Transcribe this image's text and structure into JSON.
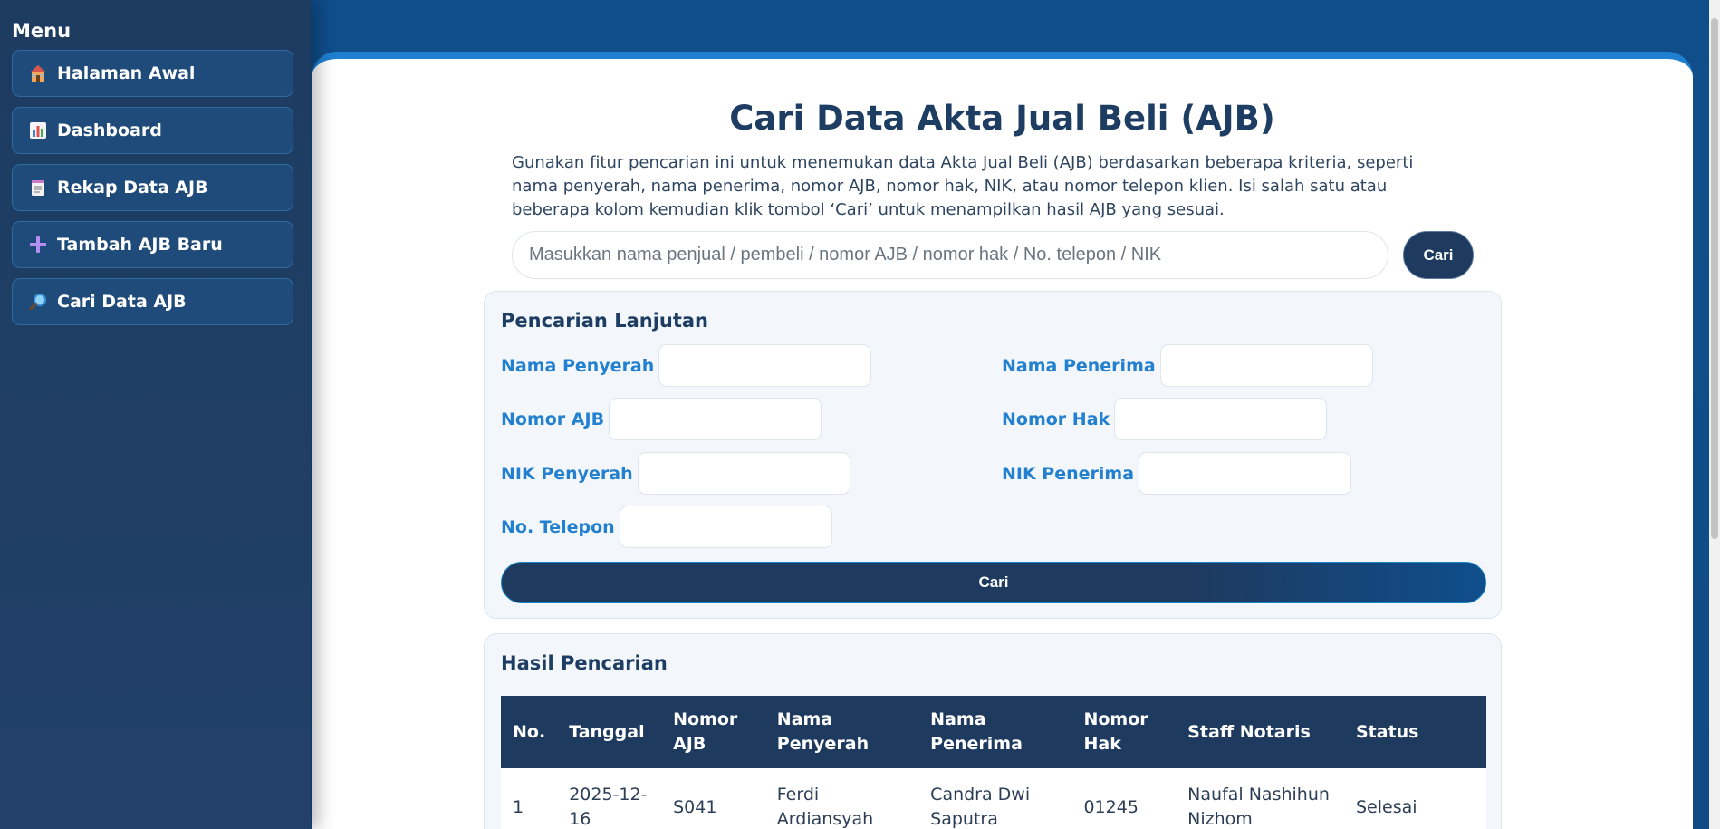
{
  "sidebar": {
    "title": "Menu",
    "items": [
      {
        "label": "Halaman Awal",
        "icon": "house-icon"
      },
      {
        "label": "Dashboard",
        "icon": "bar-chart-icon"
      },
      {
        "label": "Rekap Data AJB",
        "icon": "notepad-icon"
      },
      {
        "label": "Tambah AJB Baru",
        "icon": "plus-icon"
      },
      {
        "label": "Cari Data AJB",
        "icon": "magnifier-icon"
      }
    ]
  },
  "main": {
    "title": "Cari Data Akta Jual Beli (AJB)",
    "intro": "Gunakan fitur pencarian ini untuk menemukan data Akta Jual Beli (AJB) berdasarkan beberapa kriteria, seperti nama penyerah, nama penerima, nomor AJB, nomor hak, NIK, atau nomor telepon klien. Isi salah satu atau beberapa kolom kemudian klik tombol ‘Cari’ untuk menampilkan hasil AJB yang sesuai.",
    "search": {
      "placeholder": "Masukkan nama penjual / pembeli / nomor AJB / nomor hak / No. telepon / NIK",
      "value": "",
      "button_label": "Cari"
    },
    "advanced": {
      "title": "Pencarian Lanjutan",
      "fields": {
        "nama_penyerah": {
          "label": "Nama Penyerah",
          "value": ""
        },
        "nama_penerima": {
          "label": "Nama Penerima",
          "value": ""
        },
        "nomor_ajb": {
          "label": "Nomor AJB",
          "value": ""
        },
        "nomor_hak": {
          "label": "Nomor Hak",
          "value": ""
        },
        "nik_penyerah": {
          "label": "NIK Penyerah",
          "value": ""
        },
        "nik_penerima": {
          "label": "NIK Penerima",
          "value": ""
        },
        "no_telepon": {
          "label": "No. Telepon",
          "value": ""
        }
      },
      "button_label": "Cari"
    },
    "results": {
      "title": "Hasil Pencarian",
      "columns": [
        {
          "line1": "No.",
          "line2": ""
        },
        {
          "line1": "Tanggal",
          "line2": ""
        },
        {
          "line1": "Nomor",
          "line2": "AJB"
        },
        {
          "line1": "Nama",
          "line2": "Penyerah"
        },
        {
          "line1": "Nama",
          "line2": "Penerima"
        },
        {
          "line1": "Nomor",
          "line2": "Hak"
        },
        {
          "line1": "Staff Notaris",
          "line2": ""
        },
        {
          "line1": "Status",
          "line2": ""
        }
      ],
      "rows": [
        {
          "no": "1",
          "tanggal": {
            "line1": "2025-12-",
            "line2": "16"
          },
          "nomor_ajb": "S041",
          "nama_penyerah": {
            "line1": "Ferdi",
            "line2": "Ardiansyah"
          },
          "nama_penerima": {
            "line1": "Candra Dwi",
            "line2": "Saputra"
          },
          "nomor_hak": "01245",
          "staff_notaris": {
            "line1": "Naufal Nashihun",
            "line2": "Nizhom"
          },
          "status": "Selesai"
        }
      ]
    }
  },
  "colors": {
    "sidebar_bg": "#1d3c60",
    "nav_item_bg": "#1f4b7a",
    "header_bg": "#0f4d8b",
    "accent": "#2380cf",
    "dark_navy": "#1e3a5f",
    "card_bg": "#f3f7fc"
  }
}
